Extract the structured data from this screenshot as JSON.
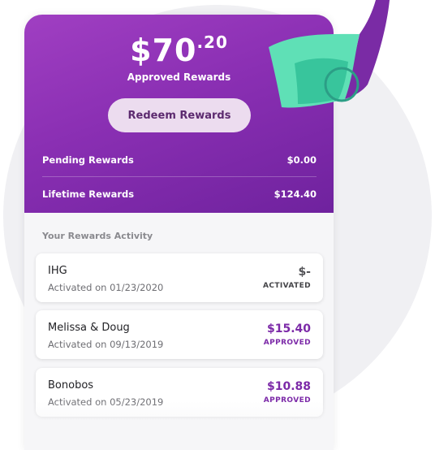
{
  "balance": {
    "currency": "$",
    "dollars": "70",
    "cents": ".20"
  },
  "approved_label": "Approved Rewards",
  "redeem_label": "Redeem Rewards",
  "pending": {
    "label": "Pending Rewards",
    "value": "$0.00"
  },
  "lifetime": {
    "label": "Lifetime Rewards",
    "value": "$124.40"
  },
  "activity_title": "Your Rewards Activity",
  "activities": [
    {
      "name": "IHG",
      "date": "Activated on 01/23/2020",
      "amount": "$-",
      "status": "ACTIVATED"
    },
    {
      "name": "Melissa & Doug",
      "date": "Activated on 09/13/2019",
      "amount": "$15.40",
      "status": "APPROVED"
    },
    {
      "name": "Bonobos",
      "date": "Activated on 05/23/2019",
      "amount": "$10.88",
      "status": "APPROVED"
    }
  ],
  "colors": {
    "brand_purple": "#8a2fb3",
    "accent_teal": "#5fe0b6",
    "approved_text": "#7c2aa8"
  },
  "icons": {
    "decoration": "dollar-bill-icon"
  }
}
